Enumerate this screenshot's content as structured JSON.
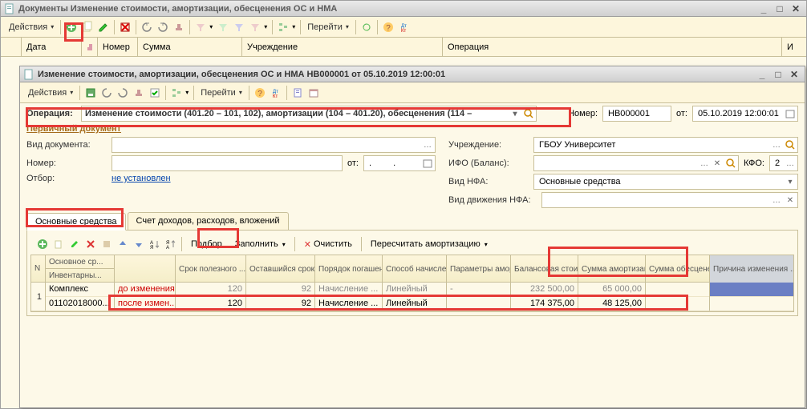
{
  "outer_window": {
    "title": "Документы  Изменение стоимости, амортизации, обесценения ОС и НМА",
    "toolbar": {
      "actions_label": "Действия",
      "goto_label": "Перейти"
    },
    "list_cols": {
      "date": "Дата",
      "number": "Номер",
      "sum": "Сумма",
      "institution": "Учреждение",
      "operation": "Операция",
      "user": "И"
    }
  },
  "inner_window": {
    "title": "Изменение стоимости, амортизации, обесценения ОС и НМА НВ000001 от 05.10.2019 12:00:01",
    "toolbar": {
      "actions_label": "Действия",
      "goto_label": "Перейти"
    },
    "op_row": {
      "label": "Операция:",
      "value": "Изменение стоимости (401.20 – 101, 102), амортизации (104 – 401.20), обесценения (114 –",
      "num_label": "Номер:",
      "num_value": "НВ000001",
      "date_label": "от:",
      "date_value": "05.10.2019 12:00:01"
    },
    "primary_doc": "Первичный документ",
    "left": {
      "doc_type_label": "Вид документа:",
      "doc_type_value": "",
      "number_label": "Номер:",
      "number_value": "",
      "ot_label": "от:",
      "ot_value": ".  .",
      "filter_label": "Отбор:",
      "filter_link": "не установлен"
    },
    "right": {
      "institution_label": "Учреждение:",
      "institution_value": "ГБОУ Университет",
      "ifo_label": "ИФО (Баланс):",
      "ifo_value": "",
      "kfo_label": "КФО:",
      "kfo_value": "2",
      "nfa_type_label": "Вид НФА:",
      "nfa_type_value": "Основные средства",
      "nfa_move_label": "Вид движения НФА:",
      "nfa_move_value": ""
    },
    "tabs": {
      "t1": "Основные средства",
      "t2": "Счет доходов, расходов, вложений"
    },
    "sub_toolbar": {
      "podbor": "Подбор",
      "fill": "Заполнить",
      "clear": "Очистить",
      "recalc": "Пересчитать амортизацию"
    },
    "grid": {
      "cols": {
        "n": "N",
        "main_top": "Основное ср...",
        "main_bottom": "Инвентарны...",
        "before_after": "",
        "useful_life": "Срок полезного ...",
        "remaining": "Оставшийся срок",
        "order": "Порядок погашения ...",
        "method": "Способ начисления ...",
        "params": "Параметры амортизации",
        "balance": "Балансовая стоимость",
        "amort": "Сумма амортизации",
        "impair": "Сумма обесценения",
        "reason": "Причина изменения ..."
      },
      "row1": {
        "n": "1",
        "main_top": "Комплекс",
        "main_bottom": "01102018000...",
        "before": "до изменения:",
        "after": "после измен...",
        "useful_life_before": "120",
        "useful_life_after": "120",
        "remaining_before": "92",
        "remaining_after": "92",
        "order_before": "Начисление ...",
        "order_after": "Начисление ...",
        "method_before": "Линейный",
        "method_after": "Линейный",
        "params_before": "-",
        "params_after": "",
        "balance_before": "232 500,00",
        "balance_after": "174 375,00",
        "amort_before": "65 000,00",
        "amort_after": "48 125,00",
        "impair_before": "",
        "impair_after": "",
        "reason": ""
      }
    }
  },
  "icons": {
    "add_green": "+",
    "arrow_down": "▾"
  }
}
